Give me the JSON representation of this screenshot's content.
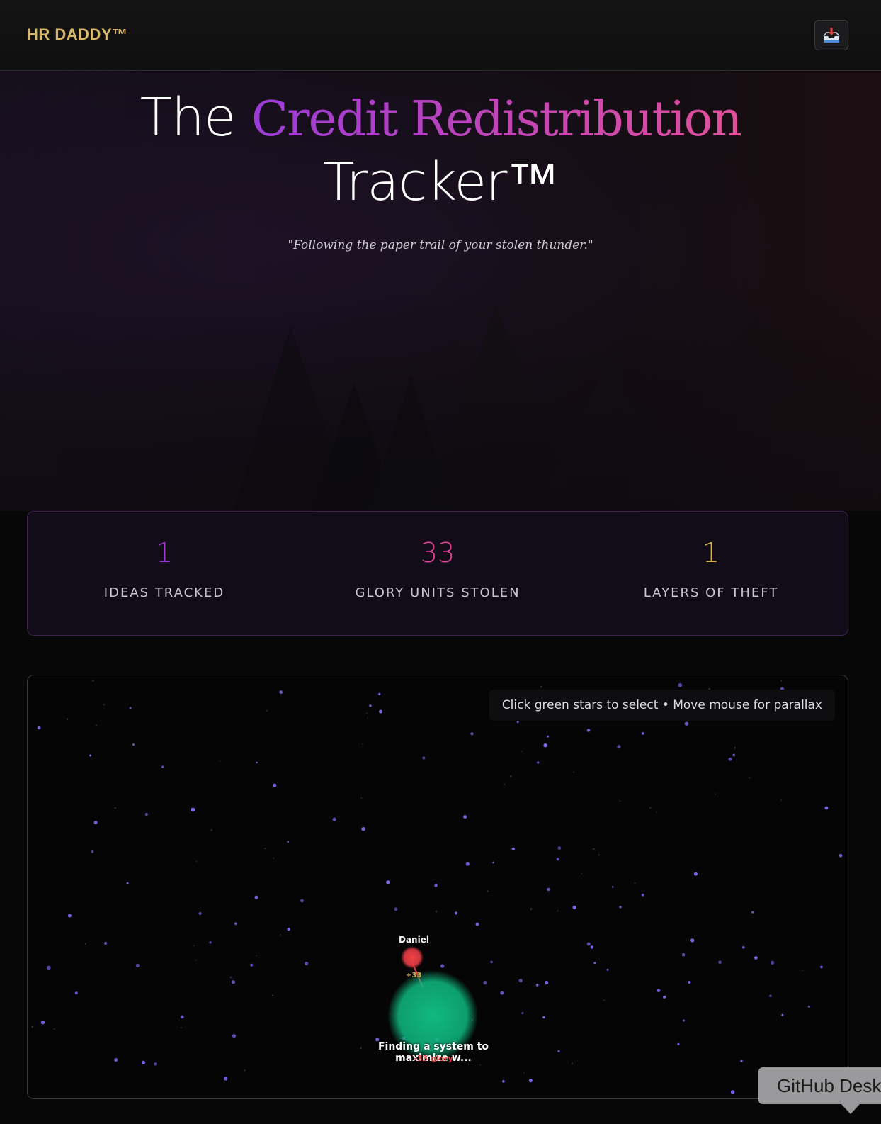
{
  "header": {
    "brand": "HR DADDY™",
    "inbox_icon": "inbox-tray-icon"
  },
  "hero": {
    "title_prefix": "The",
    "title_accent": "Credit Redistribution",
    "title_suffix": "Tracker™",
    "tagline": "\"Following the paper trail of your stolen thunder.\""
  },
  "stats": [
    {
      "value": "1",
      "label": "IDEAS TRACKED",
      "color": "#9a3ad0"
    },
    {
      "value": "33",
      "label": "GLORY UNITS STOLEN",
      "color": "#e0459a"
    },
    {
      "value": "1",
      "label": "LAYERS OF THEFT",
      "color": "#d9b24a"
    }
  ],
  "constellation": {
    "hint": "Click green stars to select • Move mouse for parallax",
    "thief": {
      "name": "Daniel",
      "gain": "+33",
      "color": "#e53a45"
    },
    "idea": {
      "title": "Finding a system to maximize w...",
      "loss": "-33 glory",
      "color": "#10b981"
    },
    "star_color": "#7c6cf0"
  },
  "github_tooltip": "GitHub Desktop"
}
